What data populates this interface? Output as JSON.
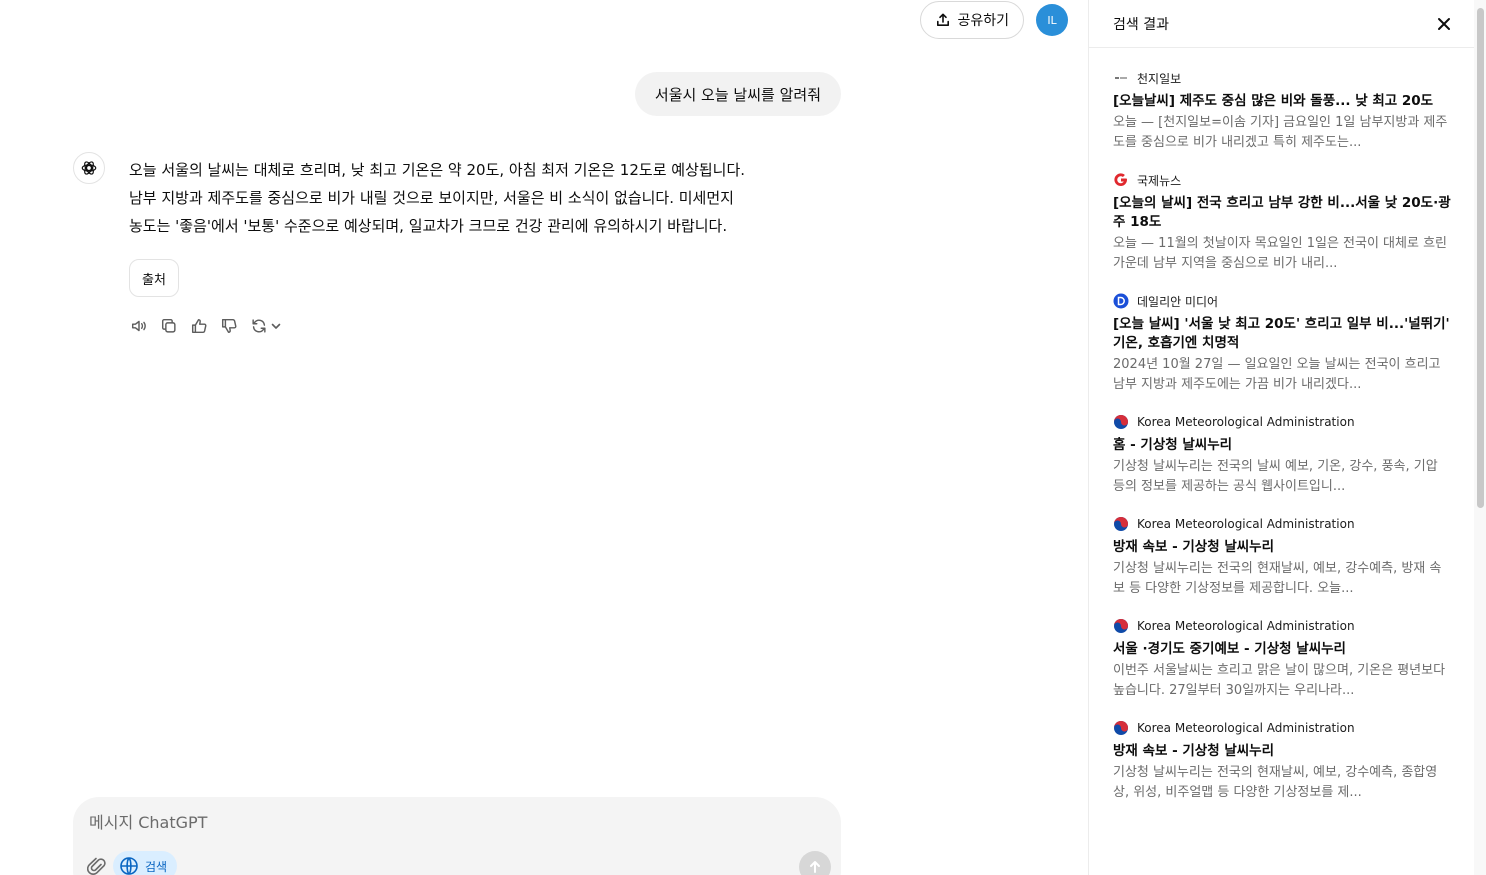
{
  "header": {
    "share_label": "공유하기",
    "avatar_initials": "IL"
  },
  "conversation": {
    "user_message": "서울시 오늘 날씨를 알려줘",
    "assistant_lines": [
      "오늘 서울의 날씨는 대체로 흐리며, 낮 최고 기온은 약 20도, 아침 최저 기온은 12도로 예상됩니다.",
      "남부 지방과 제주도를 중심으로 비가 내릴 것으로 보이지만, 서울은 비 소식이 없습니다. 미세먼지",
      "농도는 '좋음'에서 '보통' 수준으로 예상되며, 일교차가 크므로 건강 관리에 유의하시기 바랍니다."
    ],
    "sources_label": "출처"
  },
  "composer": {
    "placeholder": "메시지 ChatGPT",
    "search_label": "검색"
  },
  "panel": {
    "title": "검색 결과",
    "results": [
      {
        "source": "천지일보",
        "title": "[오늘날씨] 제주도 중심 많은 비와 돌풍... 낮 최고 20도",
        "snippet": "오늘 — [천지일보=이솜 기자] 금요일인 1일 남부지방과 제주도를 중심으로 비가 내리겠고 특히 제주도는..."
      },
      {
        "source": "국제뉴스",
        "title": "[오늘의 날씨] 전국 흐리고 남부 강한 비...서울 낮 20도·광주 18도",
        "snippet": "오늘 — 11월의 첫날이자 목요일인 1일은 전국이 대체로 흐린 가운데 남부 지역을 중심으로 비가 내리..."
      },
      {
        "source": "데일리안 미디어",
        "title": "[오늘 날씨] '서울 낮 최고 20도' 흐리고 일부 비...'널뛰기' 기온, 호흡기엔 치명적",
        "snippet": "2024년 10월 27일 — 일요일인 오늘 날씨는 전국이 흐리고 남부 지방과 제주도에는 가끔 비가 내리겠다..."
      },
      {
        "source": "Korea Meteorological Administration",
        "title": "홈 - 기상청 날씨누리",
        "snippet": "기상청 날씨누리는 전국의 날씨 예보, 기온, 강수, 풍속, 기압 등의 정보를 제공하는 공식 웹사이트입니..."
      },
      {
        "source": "Korea Meteorological Administration",
        "title": "방재 속보 - 기상청 날씨누리",
        "snippet": "기상청 날씨누리는 전국의 현재날씨, 예보, 강수예측, 방재 속보 등 다양한 기상정보를 제공합니다. 오늘..."
      },
      {
        "source": "Korea Meteorological Administration",
        "title": "서울 ·경기도 중기예보 - 기상청 날씨누리",
        "snippet": "이번주 서울날씨는 흐리고 맑은 날이 많으며, 기온은 평년보다 높습니다. 27일부터 30일까지는 우리나라..."
      },
      {
        "source": "Korea Meteorological Administration",
        "title": "방재 속보 - 기상청 날씨누리",
        "snippet": "기상청 날씨누리는 전국의 현재날씨, 예보, 강수예측, 종합영상, 위성, 비주얼맵 등 다양한 기상정보를 제..."
      }
    ]
  },
  "icons": {
    "share": "upload-icon",
    "assistant": "openai-logo-icon",
    "speaker": "speaker-icon",
    "copy": "copy-icon",
    "thumbs_up": "thumbs-up-icon",
    "thumbs_down": "thumbs-down-icon",
    "regenerate": "refresh-icon",
    "attach": "paperclip-icon",
    "globe": "globe-icon",
    "send": "arrow-up-icon",
    "close": "close-icon"
  },
  "colors": {
    "avatar": "#2a8fd9",
    "search_pill_bg": "#daeeff",
    "search_pill_text": "#0a66c2",
    "bubble": "#f2f2f2",
    "composer": "#f4f4f4"
  }
}
